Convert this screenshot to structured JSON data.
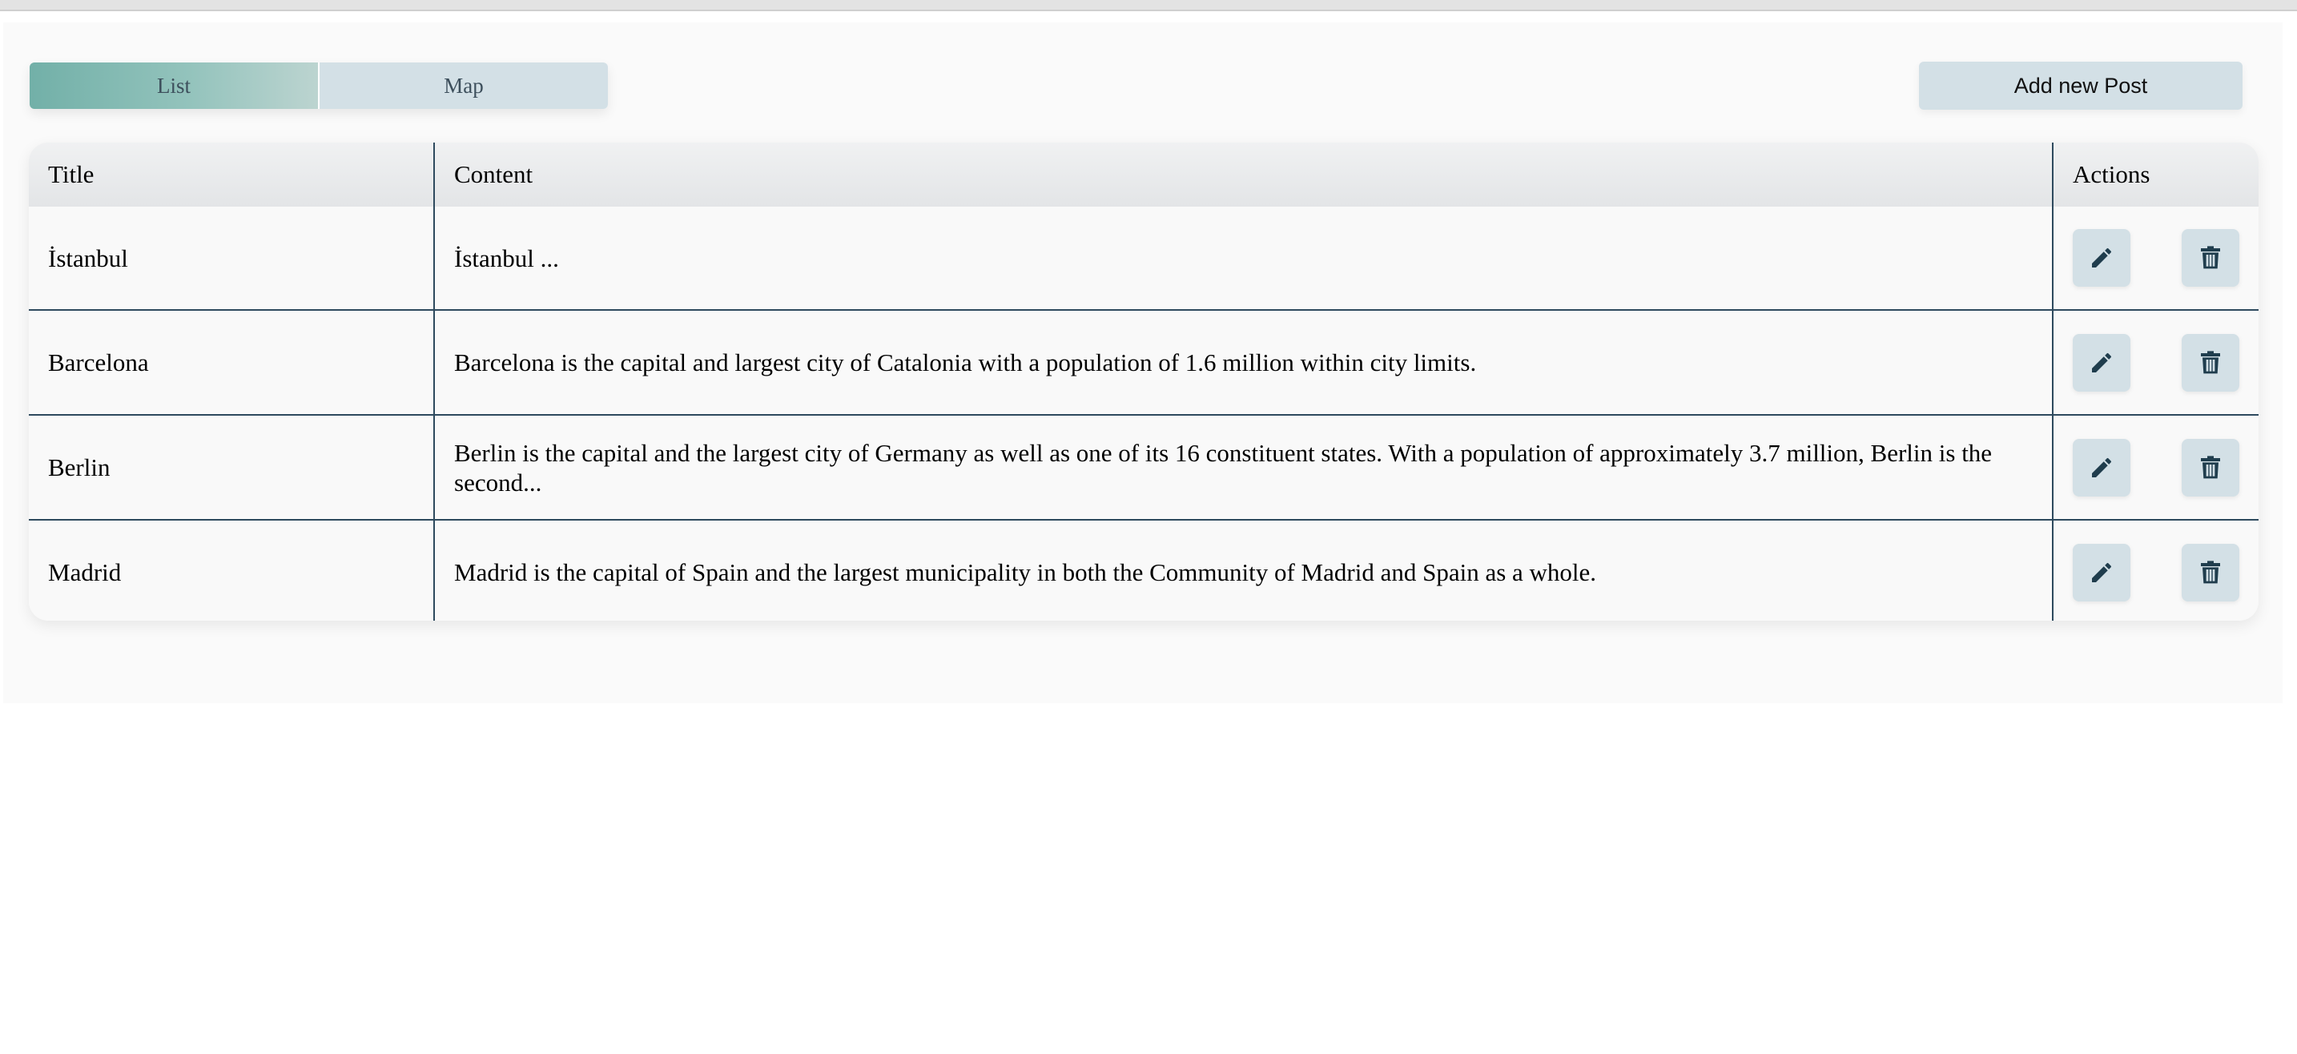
{
  "tabs": {
    "list": "List",
    "map": "Map",
    "active": "list"
  },
  "toolbar": {
    "add_label": "Add new Post"
  },
  "table": {
    "headers": {
      "title": "Title",
      "content": "Content",
      "actions": "Actions"
    },
    "rows": [
      {
        "title": "İstanbul",
        "content": "İstanbul ..."
      },
      {
        "title": "Barcelona",
        "content": "Barcelona is the capital and largest city of Catalonia with a population of 1.6 million within city limits."
      },
      {
        "title": "Berlin",
        "content": "Berlin is the capital and the largest city of Germany as well as one of its 16 constituent states. With a population of approximately 3.7 million, Berlin is the second..."
      },
      {
        "title": "Madrid",
        "content": "Madrid is the capital of Spain and the largest municipality in both the Community of Madrid and Spain as a whole."
      }
    ],
    "row_actions": [
      {
        "icon": "pencil-icon"
      },
      {
        "icon": "trash-icon"
      }
    ]
  },
  "colors": {
    "accent": "#72b0a8",
    "button_bg": "#d3e0e6",
    "icon": "#1f3d4d",
    "divider": "#2e4a5e"
  }
}
